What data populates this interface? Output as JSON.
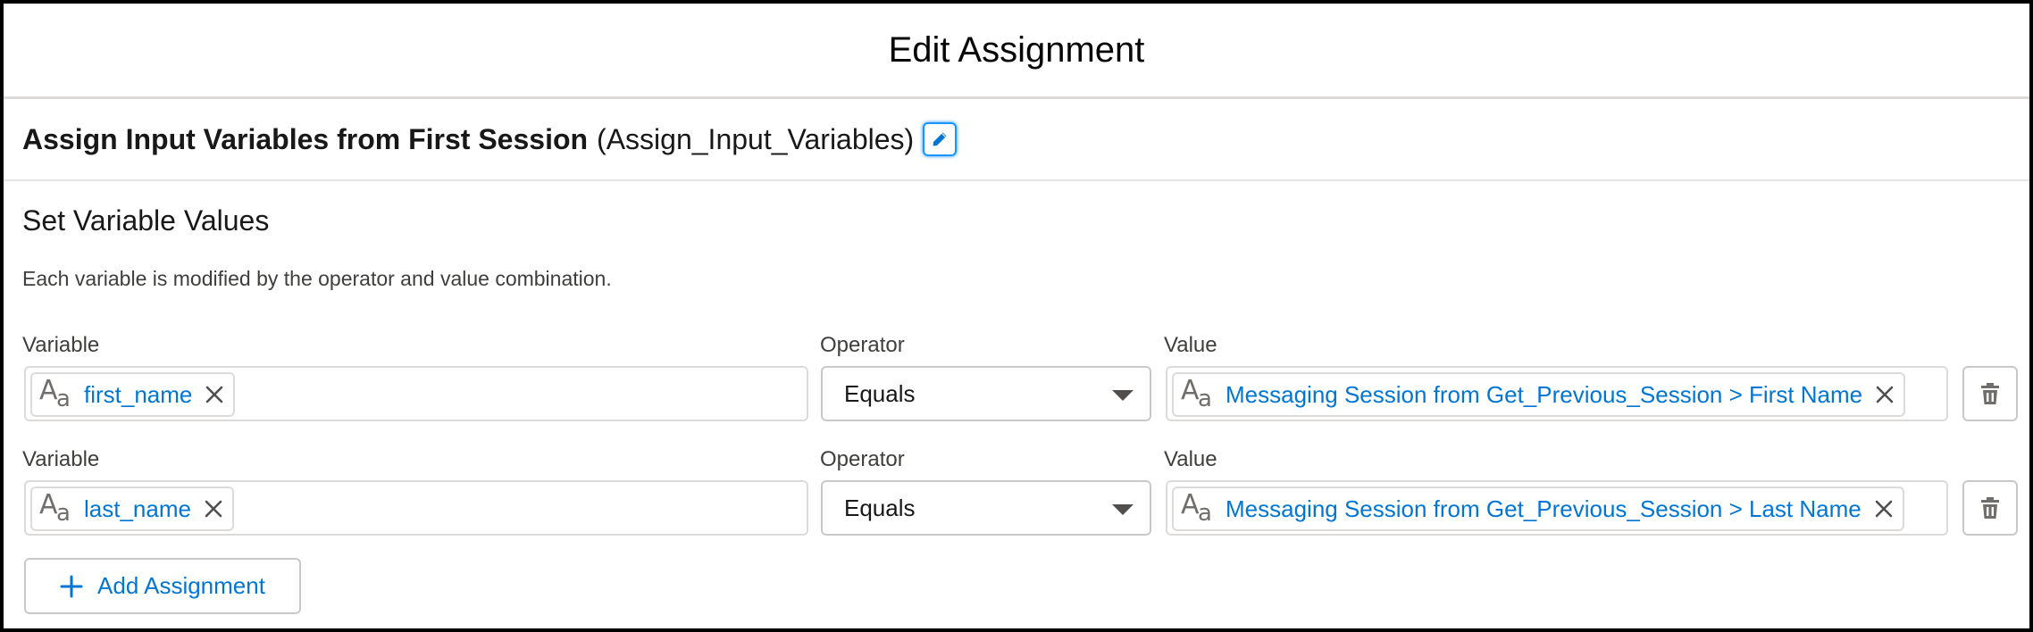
{
  "modal": {
    "title": "Edit Assignment"
  },
  "element": {
    "label": "Assign Input Variables from First Session",
    "api_name": "(Assign_Input_Variables)",
    "edit_icon": "pencil-icon"
  },
  "section": {
    "title": "Set Variable Values",
    "description": "Each variable is modified by the operator and value combination."
  },
  "labels": {
    "variable": "Variable",
    "operator": "Operator",
    "value": "Value"
  },
  "assignments": [
    {
      "variable": "first_name",
      "operator": "Equals",
      "value": "Messaging Session from Get_Previous_Session > First Name"
    },
    {
      "variable": "last_name",
      "operator": "Equals",
      "value": "Messaging Session from Get_Previous_Session > Last Name"
    }
  ],
  "icons": {
    "text_type": "text-type-icon",
    "remove": "close-icon",
    "dropdown": "chevron-down-icon",
    "delete": "trash-icon",
    "add": "plus-icon"
  },
  "add_button": {
    "label": "Add Assignment"
  },
  "colors": {
    "link": "#0176d3",
    "border": "#dddbda",
    "focus": "#1b96ff",
    "text": "#181818"
  }
}
